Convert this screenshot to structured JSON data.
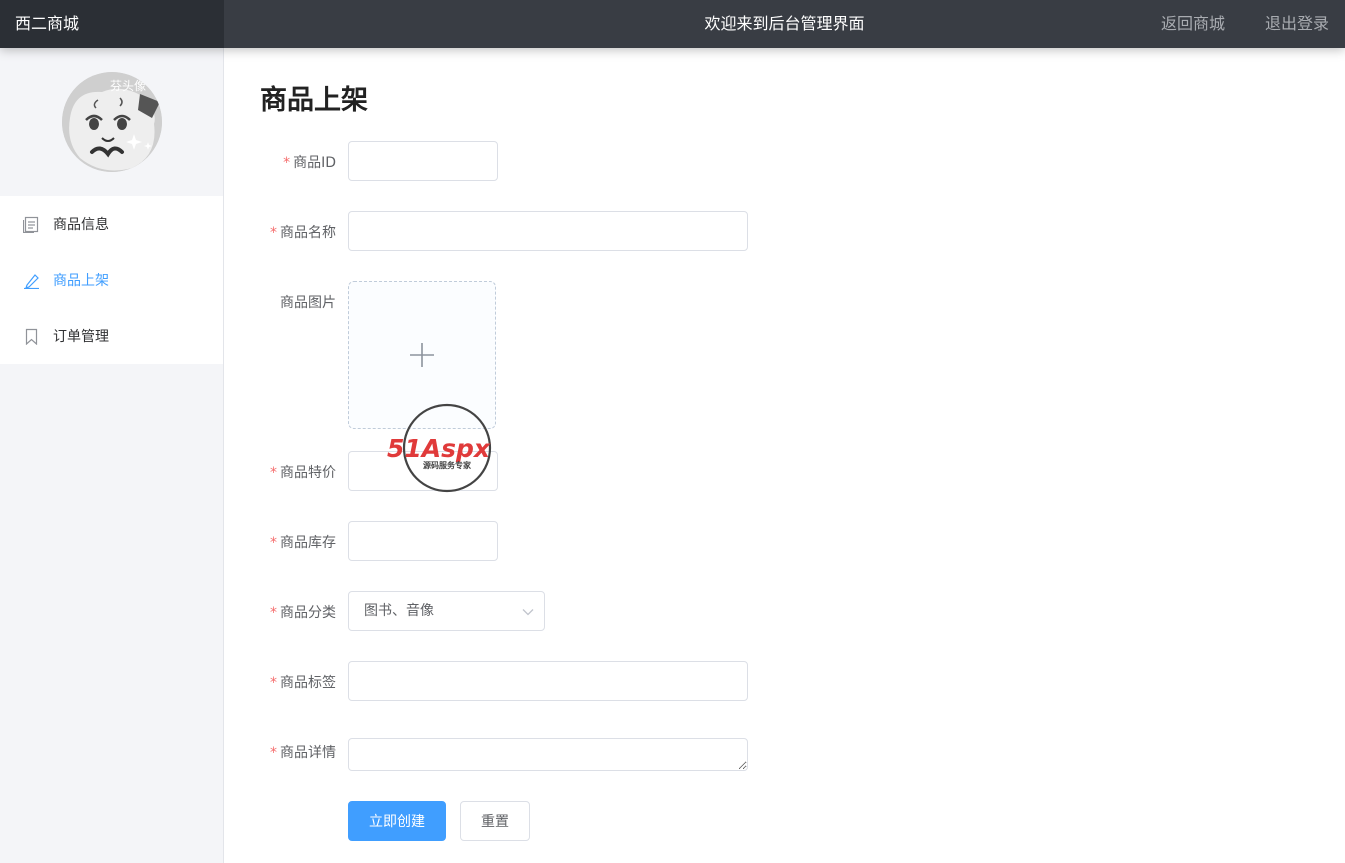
{
  "header": {
    "brand": "西二商城",
    "welcome": "欢迎来到后台管理界面",
    "links": [
      "返回商城",
      "退出登录"
    ]
  },
  "sidebar": {
    "avatar_text": "芬头像",
    "items": [
      {
        "label": "商品信息",
        "icon": "document-icon",
        "active": false
      },
      {
        "label": "商品上架",
        "icon": "edit-icon",
        "active": true
      },
      {
        "label": "订单管理",
        "icon": "bookmark-icon",
        "active": false
      }
    ]
  },
  "main": {
    "title": "商品上架",
    "form": {
      "id_label": "商品ID",
      "name_label": "商品名称",
      "image_label": "商品图片",
      "price_label": "商品特价",
      "stock_label": "商品库存",
      "category_label": "商品分类",
      "category_value": "图书、音像",
      "tags_label": "商品标签",
      "detail_label": "商品详情",
      "required_mark": "*"
    },
    "buttons": {
      "create": "立即创建",
      "reset": "重置"
    }
  },
  "watermark": {
    "logo": "51Aspx",
    "slogan": "源码服务专家"
  },
  "colors": {
    "topbar": "#393d44",
    "brand_bg": "#2b2f35",
    "accent": "#409eff",
    "required": "#f56c6c"
  }
}
